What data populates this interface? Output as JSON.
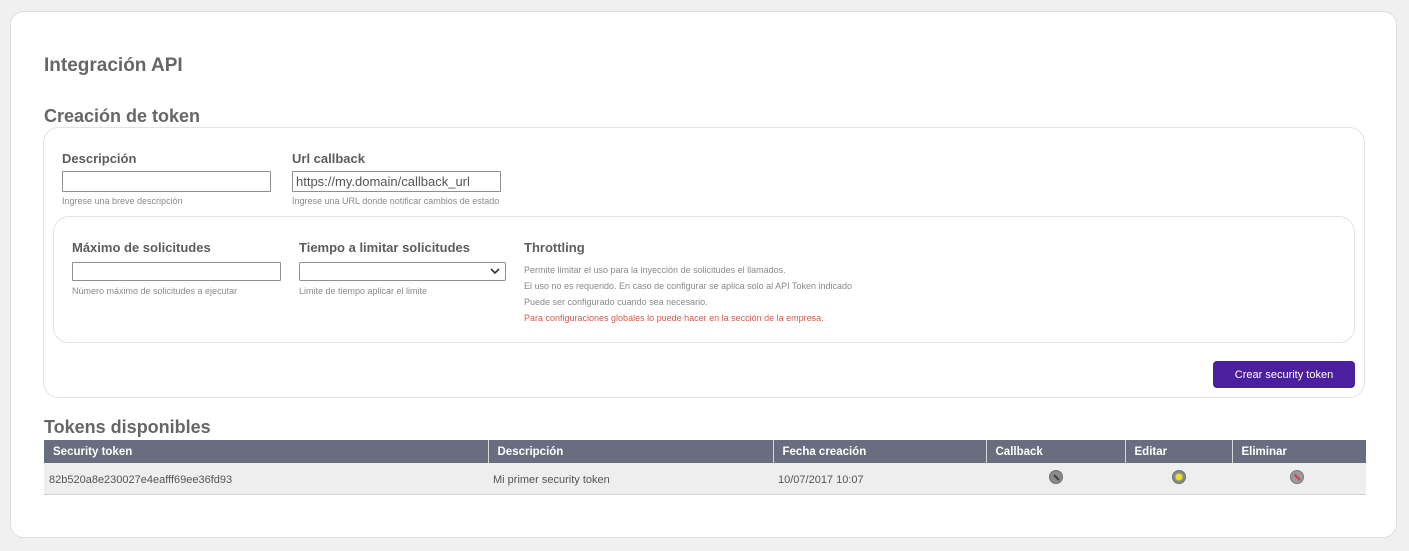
{
  "page": {
    "title": "Integración API"
  },
  "create_section": {
    "title": "Creación de token",
    "description": {
      "label": "Descripción",
      "value": "",
      "placeholder": "",
      "help": "Ingrese una breve descripción"
    },
    "callback": {
      "label": "Url callback",
      "value": "",
      "placeholder": "https://my.domain/callback_url",
      "help": "Ingrese una URL donde notificar cambios de estado"
    },
    "max_requests": {
      "label": "Máximo de solicitudes",
      "value": "",
      "help": "Número máximo de solicitudes a ejecutar"
    },
    "time_limit": {
      "label": "Tiempo a limitar solicitudes",
      "selected": "",
      "help": "Limite de tiempo aplicar el limite"
    },
    "throttling": {
      "title": "Throttling",
      "lines": [
        "Permite limitar el uso para la inyección de solicitudes el llamados.",
        "El uso no es requerido. En caso de configurar se aplica solo al API Token indicado",
        "Puede ser configurado cuando sea necesario."
      ],
      "warning": "Para configuraciones globales lo puede hacer en la sección de la empresa."
    },
    "create_button": "Crear security token"
  },
  "tokens_section": {
    "title": "Tokens disponibles",
    "columns": [
      "Security token",
      "Descripción",
      "Fecha creación",
      "Callback",
      "Editar",
      "Eliminar"
    ],
    "rows": [
      {
        "token": "82b520a8e230027e4eafff69ee36fd93",
        "description": "Mi primer security token",
        "created": "10/07/2017 10:07",
        "callback_icon": "callback-icon",
        "edit_icon": "edit-icon",
        "delete_icon": "delete-icon"
      }
    ]
  },
  "colors": {
    "primary_button": "#4b1f9e",
    "table_header": "#686d7f",
    "warning_text": "#d45a4a",
    "callback_icon": "#8a8a8a",
    "edit_icon": "#e6e02a",
    "delete_icon": "#d6404a"
  }
}
